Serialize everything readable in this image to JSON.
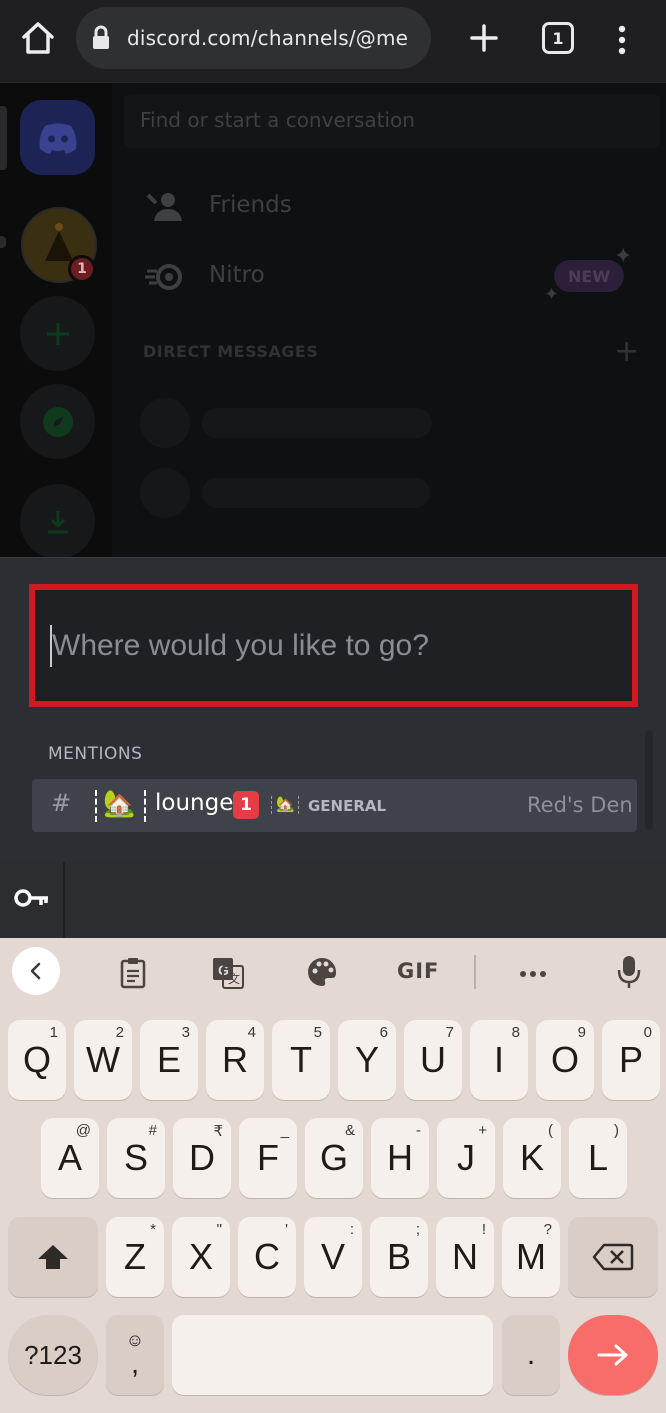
{
  "browser": {
    "url": "discord.com/channels/@me",
    "tab_count": "1"
  },
  "background": {
    "search_placeholder": "Find or start a conversation",
    "friends_label": "Friends",
    "nitro_label": "Nitro",
    "new_badge": "NEW",
    "dm_header": "DIRECT MESSAGES",
    "server_badge_count": "1"
  },
  "switcher": {
    "input_placeholder": "Where would you like to go?",
    "input_value": "",
    "section_header": "MENTIONS",
    "result": {
      "prefix_icon": "hash-icon",
      "emoji": "🏡",
      "channel_name": "lounge",
      "mention_count": "1",
      "category": "GENERAL",
      "server_name": "Red's Den"
    }
  },
  "keyboard": {
    "toolbar": [
      "back",
      "clipboard",
      "translate",
      "theme",
      "GIF",
      "more",
      "mic"
    ],
    "gif_label": "GIF",
    "rows": [
      [
        {
          "k": "Q",
          "h": "1"
        },
        {
          "k": "W",
          "h": "2"
        },
        {
          "k": "E",
          "h": "3"
        },
        {
          "k": "R",
          "h": "4"
        },
        {
          "k": "T",
          "h": "5"
        },
        {
          "k": "Y",
          "h": "6"
        },
        {
          "k": "U",
          "h": "7"
        },
        {
          "k": "I",
          "h": "8"
        },
        {
          "k": "O",
          "h": "9"
        },
        {
          "k": "P",
          "h": "0"
        }
      ],
      [
        {
          "k": "A",
          "h": "@"
        },
        {
          "k": "S",
          "h": "#"
        },
        {
          "k": "D",
          "h": "₹"
        },
        {
          "k": "F",
          "h": "_"
        },
        {
          "k": "G",
          "h": "&"
        },
        {
          "k": "H",
          "h": "-"
        },
        {
          "k": "J",
          "h": "+"
        },
        {
          "k": "K",
          "h": "("
        },
        {
          "k": "L",
          "h": ")"
        }
      ],
      [
        {
          "k": "Z",
          "h": "*"
        },
        {
          "k": "X",
          "h": "\""
        },
        {
          "k": "C",
          "h": "'"
        },
        {
          "k": "V",
          "h": ":"
        },
        {
          "k": "B",
          "h": ";"
        },
        {
          "k": "N",
          "h": "!"
        },
        {
          "k": "M",
          "h": "?"
        }
      ]
    ],
    "symbols_key": "?123",
    "comma_key": ",",
    "period_key": ".",
    "accent_color": "#f86c6a"
  },
  "colors": {
    "highlight_border": "#d21923",
    "mention_badge": "#e53d45",
    "discord_blurple": "#5865f2"
  }
}
